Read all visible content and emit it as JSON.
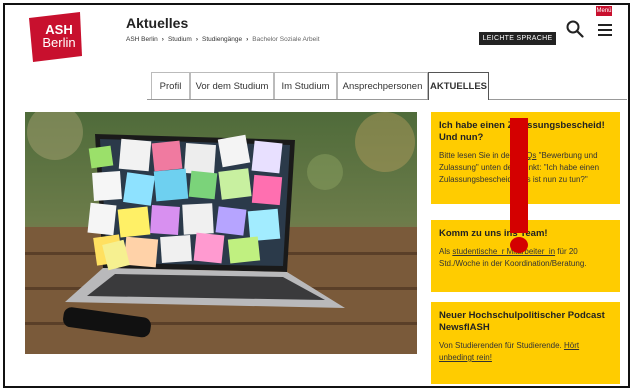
{
  "logo": {
    "line1": "ASH",
    "line2": "Berlin"
  },
  "header": {
    "title": "Aktuelles",
    "breadcrumb": [
      "ASH Berlin",
      "Studium",
      "Studiengänge",
      "Bachelor Soziale Arbeit"
    ],
    "breadcrumb_sep": "›",
    "leichte_sprache": "LEICHTE SPRACHE",
    "menu_label": "Menü"
  },
  "tabs": [
    {
      "label": "Profil"
    },
    {
      "label": "Vor dem Studium"
    },
    {
      "label": "Im Studium"
    },
    {
      "label": "Ansprechpersonen"
    },
    {
      "label": "AKTUELLES"
    }
  ],
  "cards": [
    {
      "title": "Ich habe einen Zulassungsbescheid! Und nun?",
      "text_pre": "Bitte lesen Sie in den ",
      "link": "FAQs",
      "text_post": " \"Bewerbung und Zulassung\" unten den Punkt: \"Ich habe einen Zulassungsbescheid, was ist nun zu tun?\""
    },
    {
      "title": "Komm zu uns ins Team!",
      "text_pre": "Als ",
      "link": "studentische_r Mitarbeiter_in",
      "text_post": " für 20 Std./Woche in der Koordination/Beratung."
    },
    {
      "title": "Neuer Hochschulpolitischer Podcast NewsflASH",
      "text_pre": "Von Studierenden für Studierende. ",
      "link": "Hört unbedingt rein!",
      "text_post": ""
    }
  ],
  "colors": {
    "brand_red": "#c8102e",
    "card_yellow": "#ffcc00",
    "annotation_red": "#d40000"
  },
  "icons": {
    "search": "search-icon",
    "menu": "hamburger-icon"
  }
}
